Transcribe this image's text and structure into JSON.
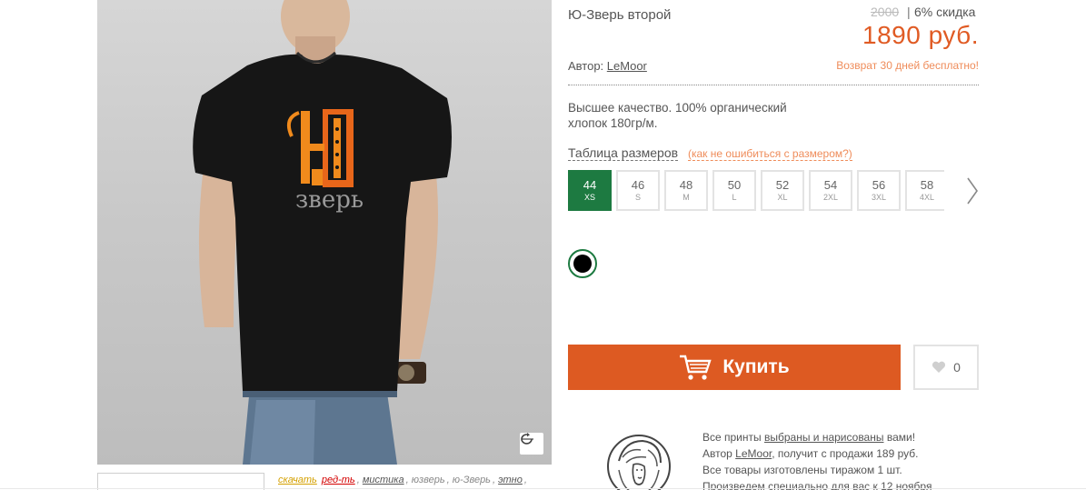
{
  "product": {
    "title": "Ю-Зверь второй",
    "old_price": "2000",
    "separator": "|",
    "discount": "6% скидка",
    "price": "1890 руб.",
    "author_prefix": "Автор:",
    "author_name": "LeMoor",
    "return_policy": "Возврат 30 дней бесплатно!",
    "description": "Высшее качество. 100% органический хлопок 180гр/м.",
    "print_text": "зверь"
  },
  "sizes": {
    "table_link": "Таблица размеров",
    "hint_link": "(как не ошибиться с размером?)",
    "selected": "44",
    "items": [
      {
        "num": "44",
        "label": "XS"
      },
      {
        "num": "46",
        "label": "S"
      },
      {
        "num": "48",
        "label": "M"
      },
      {
        "num": "50",
        "label": "L"
      },
      {
        "num": "52",
        "label": "XL"
      },
      {
        "num": "54",
        "label": "2XL"
      },
      {
        "num": "56",
        "label": "3XL"
      },
      {
        "num": "58",
        "label": "4XL"
      }
    ]
  },
  "colors": {
    "selected": "#000000",
    "accent_green": "#1d7a41",
    "accent_orange": "#dd5a22"
  },
  "actions": {
    "buy_label": "Купить",
    "like_count": "0"
  },
  "tags": [
    {
      "text": "скачать",
      "style": "hl1",
      "sep": ""
    },
    {
      "text": "ред-ть",
      "style": "hl2",
      "sep": ","
    },
    {
      "text": "мистика",
      "style": "u",
      "sep": ","
    },
    {
      "text": "юзверь",
      "style": "plain",
      "sep": ","
    },
    {
      "text": "ю-Зверь",
      "style": "plain",
      "sep": ","
    },
    {
      "text": "этно",
      "style": "u",
      "sep": ","
    }
  ],
  "info": {
    "line1_prefix": "Все принты",
    "line1_link": "выбраны и нарисованы",
    "line1_suffix": "вами!",
    "line2_prefix": "Автор",
    "line2_link": "LeMoor",
    "line2_suffix": ", получит с продажи 189 руб.",
    "line3": "Все товары изготовлены тиражом 1 шт.",
    "line4": "Произведем специально для вас к 12 ноября"
  }
}
